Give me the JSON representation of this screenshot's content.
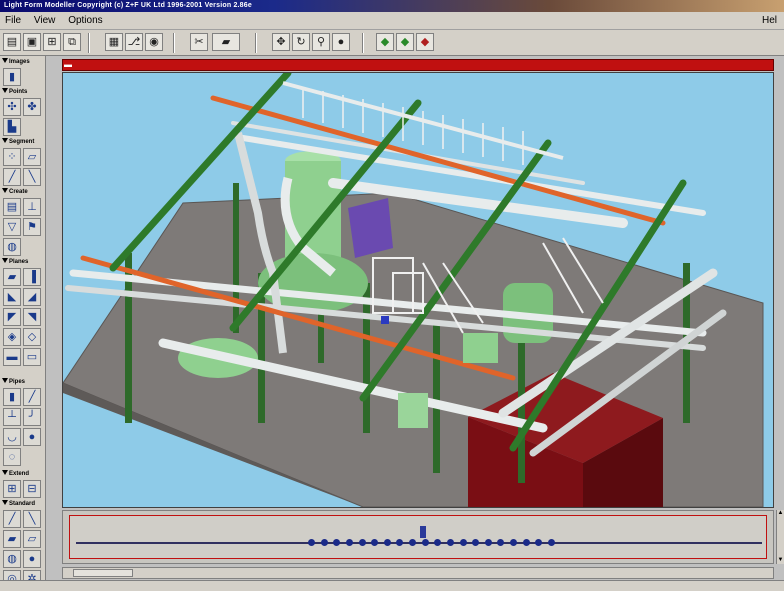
{
  "window": {
    "title": "Light Form Modeller   Copyright (c) Z+F UK Ltd 1996-2001  Version 2.86e"
  },
  "menu": {
    "items": [
      "File",
      "View",
      "Options"
    ],
    "help_label": "Hel"
  },
  "toolbar": {
    "buttons": [
      "new-icon",
      "save-icon",
      "print-icon",
      "book-icon",
      "grid-icon",
      "tree-icon",
      "globe-icon",
      "scissors-icon",
      "plane-icon",
      "move-icon",
      "rotate-icon",
      "zoom-icon",
      "sphere-icon",
      "render-icon",
      "render2-icon",
      "render3-icon"
    ]
  },
  "left_panel": {
    "sections": [
      {
        "label": "Images"
      },
      {
        "label": "Points"
      },
      {
        "label": "Segment"
      },
      {
        "label": "Create"
      },
      {
        "label": "Planes"
      },
      {
        "label": "Pipes"
      },
      {
        "label": "Extend"
      },
      {
        "label": "Standard"
      }
    ]
  },
  "timeline": {
    "keyframe_count": 20
  },
  "colors": {
    "viewport_bg": "#8ecbe8",
    "floor": "#7e7a78",
    "beam_green": "#2e7a2a",
    "pipe_orange": "#e0642a",
    "pipe_white": "#e8ecec",
    "vessel_green": "#8fd08f",
    "dark_red_block": "#7a0e14",
    "accent_red": "#c01010"
  }
}
